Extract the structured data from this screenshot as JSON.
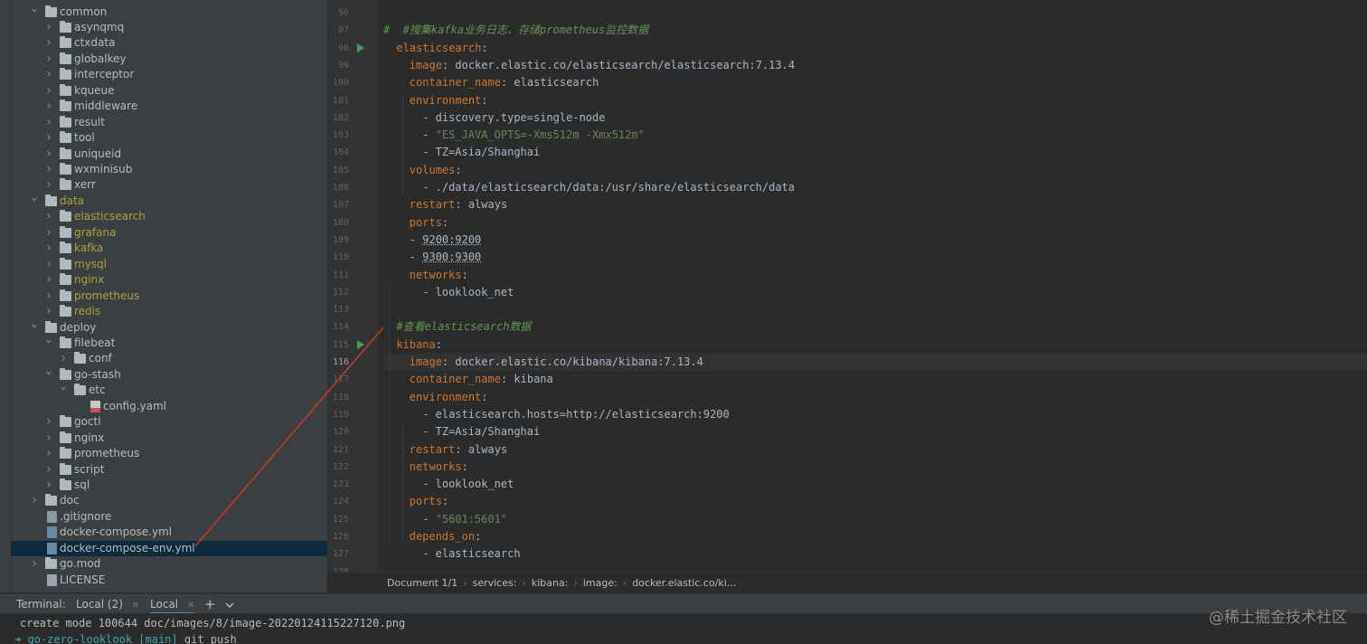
{
  "tree": {
    "items": [
      {
        "label": "common",
        "type": "folder",
        "depth": 1,
        "expanded": true,
        "olive": false
      },
      {
        "label": "asynqmq",
        "type": "folder",
        "depth": 2,
        "expanded": false,
        "olive": false
      },
      {
        "label": "ctxdata",
        "type": "folder",
        "depth": 2,
        "expanded": false,
        "olive": false
      },
      {
        "label": "globalkey",
        "type": "folder",
        "depth": 2,
        "expanded": false,
        "olive": false
      },
      {
        "label": "interceptor",
        "type": "folder",
        "depth": 2,
        "expanded": false,
        "olive": false
      },
      {
        "label": "kqueue",
        "type": "folder",
        "depth": 2,
        "expanded": false,
        "olive": false
      },
      {
        "label": "middleware",
        "type": "folder",
        "depth": 2,
        "expanded": false,
        "olive": false
      },
      {
        "label": "result",
        "type": "folder",
        "depth": 2,
        "expanded": false,
        "olive": false
      },
      {
        "label": "tool",
        "type": "folder",
        "depth": 2,
        "expanded": false,
        "olive": false
      },
      {
        "label": "uniqueid",
        "type": "folder",
        "depth": 2,
        "expanded": false,
        "olive": false
      },
      {
        "label": "wxminisub",
        "type": "folder",
        "depth": 2,
        "expanded": false,
        "olive": false
      },
      {
        "label": "xerr",
        "type": "folder",
        "depth": 2,
        "expanded": false,
        "olive": false
      },
      {
        "label": "data",
        "type": "folder",
        "depth": 1,
        "expanded": true,
        "olive": true
      },
      {
        "label": "elasticsearch",
        "type": "folder",
        "depth": 2,
        "expanded": false,
        "olive": true
      },
      {
        "label": "grafana",
        "type": "folder",
        "depth": 2,
        "expanded": false,
        "olive": true
      },
      {
        "label": "kafka",
        "type": "folder",
        "depth": 2,
        "expanded": false,
        "olive": true
      },
      {
        "label": "mysql",
        "type": "folder",
        "depth": 2,
        "expanded": false,
        "olive": true
      },
      {
        "label": "nginx",
        "type": "folder",
        "depth": 2,
        "expanded": false,
        "olive": true
      },
      {
        "label": "prometheus",
        "type": "folder",
        "depth": 2,
        "expanded": false,
        "olive": true
      },
      {
        "label": "redis",
        "type": "folder",
        "depth": 2,
        "expanded": false,
        "olive": true
      },
      {
        "label": "deploy",
        "type": "folder",
        "depth": 1,
        "expanded": true,
        "olive": false
      },
      {
        "label": "filebeat",
        "type": "folder",
        "depth": 2,
        "expanded": true,
        "olive": false
      },
      {
        "label": "conf",
        "type": "folder",
        "depth": 3,
        "expanded": false,
        "olive": false
      },
      {
        "label": "go-stash",
        "type": "folder",
        "depth": 2,
        "expanded": true,
        "olive": false
      },
      {
        "label": "etc",
        "type": "folder",
        "depth": 3,
        "expanded": true,
        "olive": false
      },
      {
        "label": "config.yaml",
        "type": "yaml",
        "depth": 4,
        "olive": false
      },
      {
        "label": "goctl",
        "type": "folder",
        "depth": 2,
        "expanded": false,
        "olive": false
      },
      {
        "label": "nginx",
        "type": "folder",
        "depth": 2,
        "expanded": false,
        "olive": false
      },
      {
        "label": "prometheus",
        "type": "folder",
        "depth": 2,
        "expanded": false,
        "olive": false
      },
      {
        "label": "script",
        "type": "folder",
        "depth": 2,
        "expanded": false,
        "olive": false
      },
      {
        "label": "sql",
        "type": "folder",
        "depth": 2,
        "expanded": false,
        "olive": false
      },
      {
        "label": "doc",
        "type": "folder",
        "depth": 1,
        "expanded": false,
        "olive": false
      },
      {
        "label": ".gitignore",
        "type": "git",
        "depth": 1,
        "olive": false
      },
      {
        "label": "docker-compose.yml",
        "type": "yml",
        "depth": 1,
        "olive": false
      },
      {
        "label": "docker-compose-env.yml",
        "type": "yml",
        "depth": 1,
        "olive": false,
        "selected": true
      },
      {
        "label": "go.mod",
        "type": "folder",
        "depth": 1,
        "expanded": false,
        "olive": false
      },
      {
        "label": "LICENSE",
        "type": "file",
        "depth": 1,
        "olive": false
      }
    ]
  },
  "editor": {
    "current_line": 116,
    "lines": [
      {
        "n": 96,
        "indent": 0,
        "parts": []
      },
      {
        "n": 97,
        "indent": 0,
        "parts": [
          {
            "t": "#  #搜集kafka业务日志、存储prometheus监控数据",
            "c": "c"
          }
        ]
      },
      {
        "n": 98,
        "indent": 1,
        "run": true,
        "parts": [
          {
            "t": "elasticsearch",
            "c": "k"
          },
          {
            "t": ":",
            "c": ""
          }
        ]
      },
      {
        "n": 99,
        "indent": 2,
        "parts": [
          {
            "t": "image",
            "c": "k"
          },
          {
            "t": ": docker.elastic.co/elasticsearch/elasticsearch:7.13.4",
            "c": ""
          }
        ]
      },
      {
        "n": 100,
        "indent": 2,
        "parts": [
          {
            "t": "container_name",
            "c": "k"
          },
          {
            "t": ": elasticsearch",
            "c": ""
          }
        ]
      },
      {
        "n": 101,
        "indent": 2,
        "parts": [
          {
            "t": "environment",
            "c": "k"
          },
          {
            "t": ":",
            "c": ""
          }
        ]
      },
      {
        "n": 102,
        "indent": 3,
        "parts": [
          {
            "t": "- discovery.type=single-node",
            "c": ""
          }
        ]
      },
      {
        "n": 103,
        "indent": 3,
        "parts": [
          {
            "t": "- ",
            "c": ""
          },
          {
            "t": "\"ES_JAVA_OPTS=-Xms512m -Xmx512m\"",
            "c": "s"
          }
        ]
      },
      {
        "n": 104,
        "indent": 3,
        "parts": [
          {
            "t": "- TZ=Asia/Shanghai",
            "c": ""
          }
        ]
      },
      {
        "n": 105,
        "indent": 2,
        "parts": [
          {
            "t": "volumes",
            "c": "k"
          },
          {
            "t": ":",
            "c": ""
          }
        ]
      },
      {
        "n": 106,
        "indent": 3,
        "parts": [
          {
            "t": "- ./data/elasticsearch/data:/usr/share/elasticsearch/data",
            "c": ""
          }
        ]
      },
      {
        "n": 107,
        "indent": 2,
        "parts": [
          {
            "t": "restart",
            "c": "k"
          },
          {
            "t": ": always",
            "c": ""
          }
        ]
      },
      {
        "n": 108,
        "indent": 2,
        "parts": [
          {
            "t": "ports",
            "c": "k"
          },
          {
            "t": ":",
            "c": ""
          }
        ]
      },
      {
        "n": 109,
        "indent": 2,
        "parts": [
          {
            "t": "- ",
            "c": ""
          },
          {
            "t": "9200:9200",
            "c": "u"
          }
        ]
      },
      {
        "n": 110,
        "indent": 2,
        "parts": [
          {
            "t": "- ",
            "c": ""
          },
          {
            "t": "9300:9300",
            "c": "u"
          }
        ]
      },
      {
        "n": 111,
        "indent": 2,
        "parts": [
          {
            "t": "networks",
            "c": "k"
          },
          {
            "t": ":",
            "c": ""
          }
        ]
      },
      {
        "n": 112,
        "indent": 3,
        "parts": [
          {
            "t": "- looklook_net",
            "c": ""
          }
        ]
      },
      {
        "n": 113,
        "indent": 0,
        "parts": []
      },
      {
        "n": 114,
        "indent": 1,
        "parts": [
          {
            "t": "#查看elasticsearch数据",
            "c": "c"
          }
        ]
      },
      {
        "n": 115,
        "indent": 1,
        "run": true,
        "parts": [
          {
            "t": "kibana",
            "c": "k"
          },
          {
            "t": ":",
            "c": ""
          }
        ]
      },
      {
        "n": 116,
        "indent": 2,
        "parts": [
          {
            "t": "image",
            "c": "k"
          },
          {
            "t": ": docker.elastic.co/kibana/kibana:7.13.4",
            "c": ""
          }
        ]
      },
      {
        "n": 117,
        "indent": 2,
        "parts": [
          {
            "t": "container_name",
            "c": "k"
          },
          {
            "t": ": kibana",
            "c": ""
          }
        ]
      },
      {
        "n": 118,
        "indent": 2,
        "parts": [
          {
            "t": "environment",
            "c": "k"
          },
          {
            "t": ":",
            "c": ""
          }
        ]
      },
      {
        "n": 119,
        "indent": 3,
        "parts": [
          {
            "t": "- elasticsearch.hosts=http://elasticsearch:9200",
            "c": ""
          }
        ]
      },
      {
        "n": 120,
        "indent": 3,
        "parts": [
          {
            "t": "- TZ=Asia/Shanghai",
            "c": ""
          }
        ]
      },
      {
        "n": 121,
        "indent": 2,
        "parts": [
          {
            "t": "restart",
            "c": "k"
          },
          {
            "t": ": always",
            "c": ""
          }
        ]
      },
      {
        "n": 122,
        "indent": 2,
        "parts": [
          {
            "t": "networks",
            "c": "k"
          },
          {
            "t": ":",
            "c": ""
          }
        ]
      },
      {
        "n": 123,
        "indent": 3,
        "parts": [
          {
            "t": "- looklook_net",
            "c": ""
          }
        ]
      },
      {
        "n": 124,
        "indent": 2,
        "parts": [
          {
            "t": "ports",
            "c": "k"
          },
          {
            "t": ":",
            "c": ""
          }
        ]
      },
      {
        "n": 125,
        "indent": 3,
        "parts": [
          {
            "t": "- ",
            "c": ""
          },
          {
            "t": "\"5601:5601\"",
            "c": "s"
          }
        ]
      },
      {
        "n": 126,
        "indent": 2,
        "parts": [
          {
            "t": "depends_on",
            "c": "k"
          },
          {
            "t": ":",
            "c": ""
          }
        ]
      },
      {
        "n": 127,
        "indent": 3,
        "parts": [
          {
            "t": "- elasticsearch",
            "c": ""
          }
        ]
      },
      {
        "n": 128,
        "indent": 0,
        "parts": []
      }
    ]
  },
  "breadcrumb": [
    "Document 1/1",
    "services:",
    "kibana:",
    "image:",
    "docker.elastic.co/ki..."
  ],
  "terminal": {
    "title": "Terminal:",
    "tabs": [
      "Local (2)",
      "Local"
    ],
    "add_icon": "plus-icon",
    "dropdown_icon": "chevron-down-icon",
    "line1": "create mode 100644 doc/images/8/image-20220124115227120.png",
    "prompt_dir": "go-zero-looklook",
    "prompt_branch": "[main]",
    "prompt_cmd": " git push"
  },
  "watermark": "@稀土掘金技术社区",
  "colors": {
    "keyword": "#cc7832",
    "string": "#6a8759",
    "comment": "#629755",
    "arrow": "#c0392b"
  }
}
